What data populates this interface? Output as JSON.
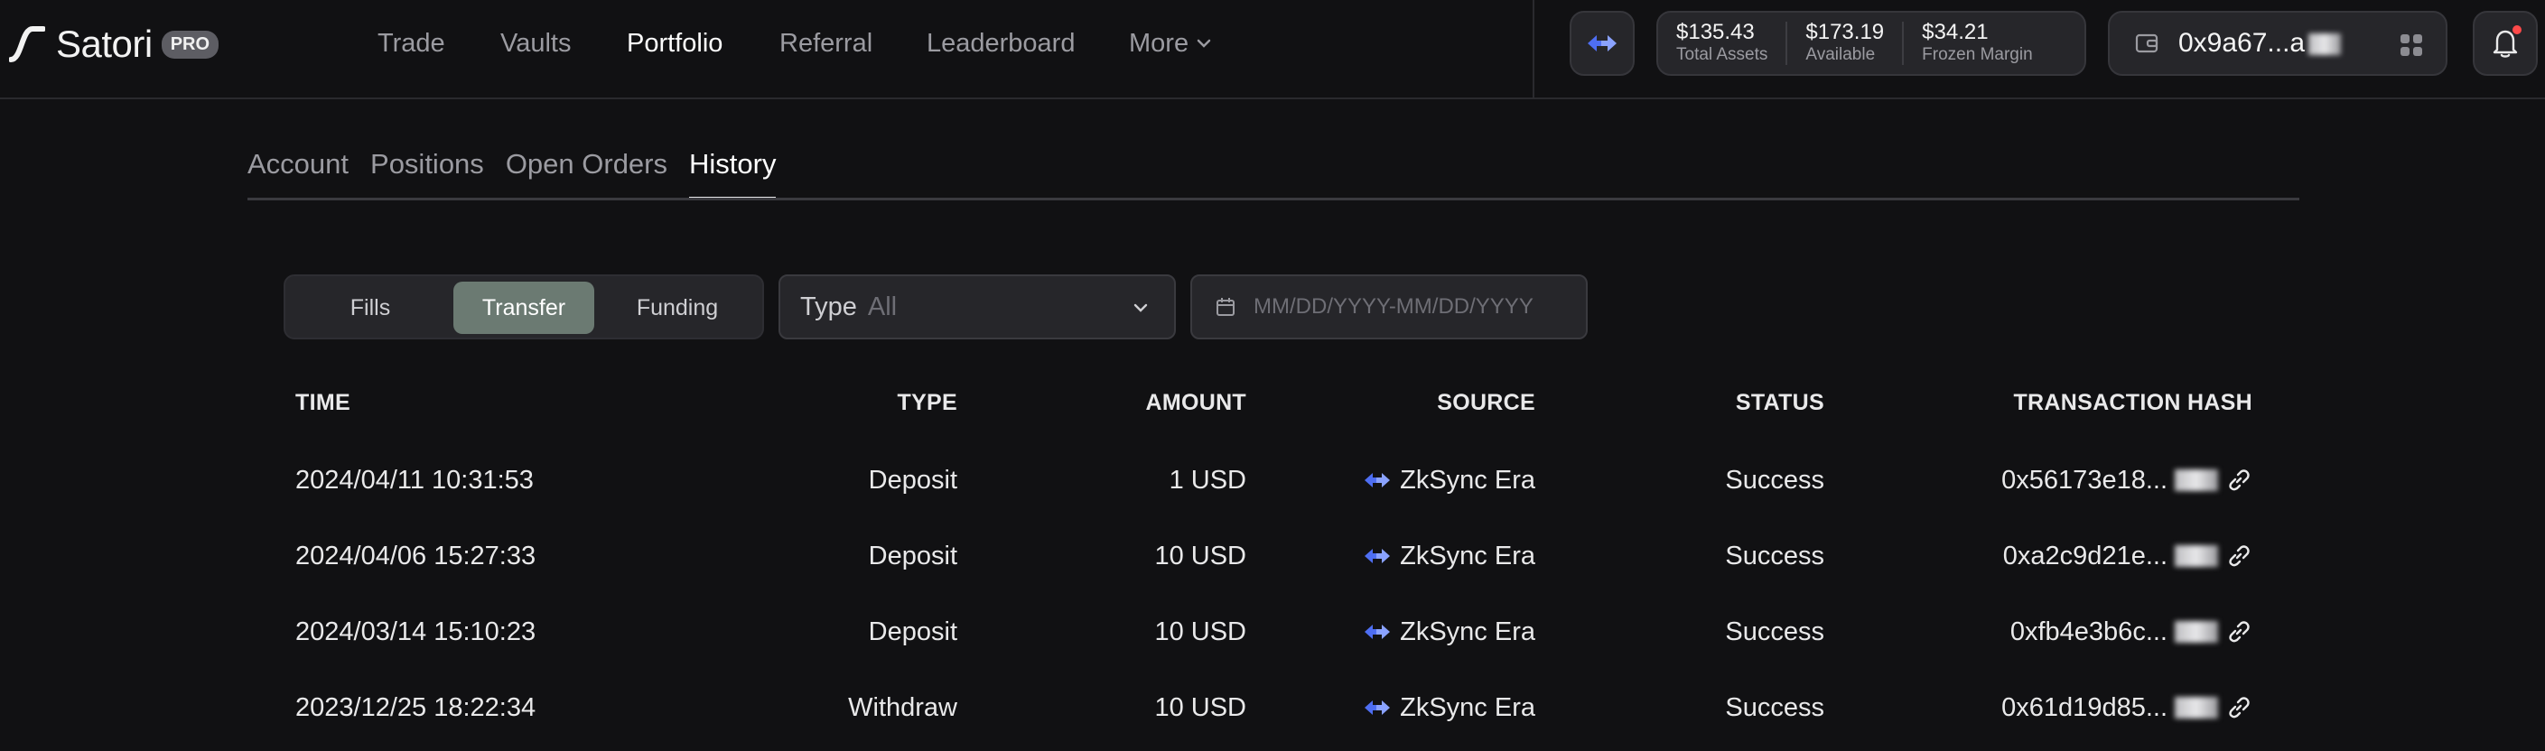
{
  "brand": {
    "name": "Satori",
    "badge": "PRO"
  },
  "nav": {
    "items": [
      "Trade",
      "Vaults",
      "Portfolio",
      "Referral",
      "Leaderboard"
    ],
    "more_label": "More",
    "active": "Portfolio"
  },
  "account": {
    "total_assets_value": "$135.43",
    "total_assets_label": "Total Assets",
    "available_value": "$173.19",
    "available_label": "Available",
    "frozen_value": "$34.21",
    "frozen_label": "Frozen Margin",
    "wallet_address": "0x9a67...a"
  },
  "tabs": [
    "Account",
    "Positions",
    "Open Orders",
    "History"
  ],
  "active_tab": "History",
  "history_filter": {
    "segments": [
      "Fills",
      "Transfer",
      "Funding"
    ],
    "active_segment": "Transfer",
    "type_label": "Type",
    "type_value": "All",
    "date_placeholder": "MM/DD/YYYY-MM/DD/YYYY"
  },
  "table": {
    "headers": [
      "TIME",
      "TYPE",
      "AMOUNT",
      "SOURCE",
      "STATUS",
      "TRANSACTION HASH"
    ],
    "rows": [
      {
        "time": "2024/04/11 10:31:53",
        "type": "Deposit",
        "amount": "1 USD",
        "source": "ZkSync Era",
        "status": "Success",
        "hash": "0x56173e18..."
      },
      {
        "time": "2024/04/06 15:27:33",
        "type": "Deposit",
        "amount": "10 USD",
        "source": "ZkSync Era",
        "status": "Success",
        "hash": "0xa2c9d21e..."
      },
      {
        "time": "2024/03/14 15:10:23",
        "type": "Deposit",
        "amount": "10 USD",
        "source": "ZkSync Era",
        "status": "Success",
        "hash": "0xfb4e3b6c..."
      },
      {
        "time": "2023/12/25 18:22:34",
        "type": "Withdraw",
        "amount": "10 USD",
        "source": "ZkSync Era",
        "status": "Success",
        "hash": "0x61d19d85..."
      }
    ]
  },
  "colors": {
    "background": "#111113",
    "panel": "#26262a",
    "active_segment": "#6b7a72",
    "zksync_blue": "#4e6ef2",
    "notification_dot": "#ff4a4a"
  }
}
